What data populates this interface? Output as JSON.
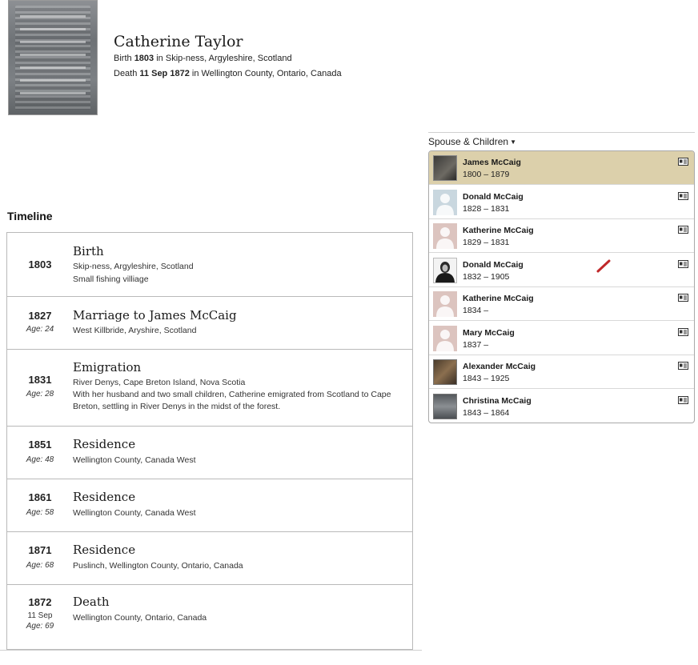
{
  "person": {
    "name": "Catherine Taylor",
    "birth": {
      "label": "Birth",
      "date": "1803",
      "place": "in Skip-ness, Argyleshire, Scotland"
    },
    "death": {
      "label": "Death",
      "date": "11 Sep 1872",
      "place": "in Wellington County, Ontario, Canada"
    }
  },
  "timeline": {
    "title": "Timeline",
    "events": [
      {
        "year": "1803",
        "age": "",
        "date": "",
        "title": "Birth",
        "place": "Skip-ness, Argyleshire, Scotland",
        "note": "Small fishing villiage"
      },
      {
        "year": "1827",
        "age": "Age: 24",
        "date": "",
        "title": "Marriage to James McCaig",
        "place": "West Killbride, Aryshire, Scotland",
        "note": ""
      },
      {
        "year": "1831",
        "age": "Age: 28",
        "date": "",
        "title": "Emigration",
        "place": "River Denys, Cape Breton Island, Nova Scotia",
        "note": "With her husband and two small children, Catherine emigrated from Scotland to Cape Breton, settling in River Denys in the midst of the forest."
      },
      {
        "year": "1851",
        "age": "Age: 48",
        "date": "",
        "title": "Residence",
        "place": "Wellington County, Canada West",
        "note": ""
      },
      {
        "year": "1861",
        "age": "Age: 58",
        "date": "",
        "title": "Residence",
        "place": "Wellington County, Canada West",
        "note": ""
      },
      {
        "year": "1871",
        "age": "Age: 68",
        "date": "",
        "title": "Residence",
        "place": "Puslinch, Wellington County, Ontario, Canada",
        "note": ""
      },
      {
        "year": "1872",
        "age": "Age: 69",
        "date": "11 Sep",
        "title": "Death",
        "place": "Wellington County, Ontario, Canada",
        "note": ""
      }
    ]
  },
  "family": {
    "title": "Spouse & Children",
    "members": [
      {
        "name": "James McCaig",
        "dates": "1800 – 1879",
        "thumb": "photo-dark",
        "selected": true
      },
      {
        "name": "Donald McCaig",
        "dates": "1828 – 1831",
        "thumb": "silhouette-blue",
        "selected": false
      },
      {
        "name": "Katherine McCaig",
        "dates": "1829 – 1831",
        "thumb": "silhouette-pink",
        "selected": false
      },
      {
        "name": "Donald McCaig",
        "dates": "1832 – 1905",
        "thumb": "portrait-bw",
        "selected": false
      },
      {
        "name": "Katherine McCaig",
        "dates": "1834 –",
        "thumb": "silhouette-pink",
        "selected": false
      },
      {
        "name": "Mary McCaig",
        "dates": "1837 –",
        "thumb": "silhouette-pink",
        "selected": false
      },
      {
        "name": "Alexander McCaig",
        "dates": "1843 – 1925",
        "thumb": "photo-brown",
        "selected": false
      },
      {
        "name": "Christina McCaig",
        "dates": "1843 – 1864",
        "thumb": "photo-stone",
        "selected": false
      }
    ]
  },
  "colors": {
    "selected_row": "#dcd0ab",
    "border": "#b9b9b9",
    "pencil": "#c0282a"
  }
}
